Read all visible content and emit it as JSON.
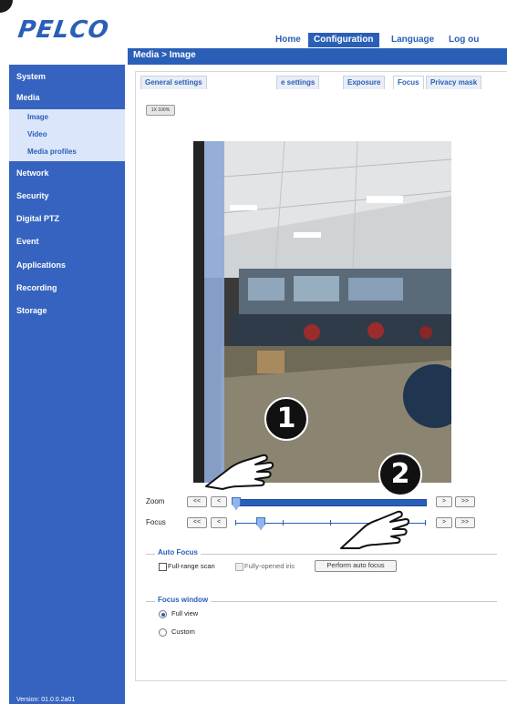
{
  "header": {
    "logo_text": "PELCO",
    "nav": [
      "Home",
      "Configuration",
      "Language",
      "Log ou"
    ],
    "breadcrumb": "Media > Image"
  },
  "sidebar": {
    "items": [
      "System",
      "Media",
      "Network",
      "Security",
      "Digital PTZ",
      "Event",
      "Applications",
      "Recording",
      "Storage"
    ],
    "media_subitems": [
      "Image",
      "Video",
      "Media profiles"
    ],
    "version": "Version: 01.0.0.2a01"
  },
  "tabs": [
    "General settings",
    "e settings",
    "Exposure",
    "Focus",
    "Privacy mask"
  ],
  "active_tab": "Focus",
  "zoom_level": "1X 100%",
  "controls": {
    "zoom_label": "Zoom",
    "focus_label": "Focus",
    "btn_fast_back": "<<",
    "btn_back": "<",
    "btn_fwd": ">",
    "btn_fast_fwd": ">>",
    "zoom_position_fraction": 0.0,
    "focus_position_fraction": 0.13
  },
  "auto_focus": {
    "title": "Auto Focus",
    "full_range_scan": "Full-range scan",
    "fully_opened_iris": "Fully-opened iris",
    "perform_button": "Perform auto focus"
  },
  "focus_window": {
    "title": "Focus window",
    "options": [
      "Full view",
      "Custom"
    ],
    "selected": "Full view"
  },
  "callouts": [
    "1",
    "2"
  ],
  "colors": {
    "brand_blue": "#2a5fb8",
    "sidebar_blue": "#3563bf"
  }
}
